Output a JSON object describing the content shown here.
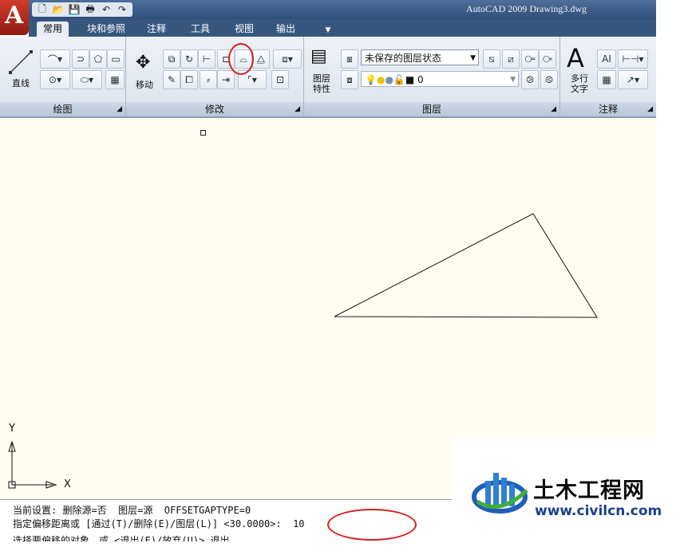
{
  "window": {
    "title": "AutoCAD 2009 Drawing3.dwg",
    "logo_letter": "A"
  },
  "quick_access": [
    "new-icon",
    "open-icon",
    "save-icon",
    "print-icon",
    "undo-icon",
    "redo-icon"
  ],
  "tabs": [
    {
      "label": "常用",
      "active": true
    },
    {
      "label": "块和参照",
      "active": false
    },
    {
      "label": "注释",
      "active": false
    },
    {
      "label": "工具",
      "active": false
    },
    {
      "label": "视图",
      "active": false
    },
    {
      "label": "输出",
      "active": false
    }
  ],
  "panels": {
    "draw": {
      "title": "绘图",
      "line_label": "直线"
    },
    "modify": {
      "title": "修改",
      "move_label": "移动"
    },
    "layers": {
      "title": "图层",
      "props_label_1": "图层",
      "props_label_2": "特性",
      "layer_state": "未保存的图层状态",
      "current_layer": "0"
    },
    "annotation": {
      "title": "注释",
      "mtext_label_1": "多行",
      "mtext_label_2": "文字"
    }
  },
  "ucs": {
    "x_label": "X",
    "y_label": "Y"
  },
  "command_line": {
    "line1": "当前设置: 删除源=否  图层=源  OFFSETGAPTYPE=0",
    "line2": "指定偏移距离或 [通过(T)/删除(E)/图层(L)] <30.0000>:  10",
    "line3": "选择要偏移的对象，或 <退出(E)/放弃(U)> 退出"
  },
  "watermark": {
    "title": "土木工程网",
    "url": "www.civilcn.com"
  },
  "colors": {
    "annotation_circle": "#d41f1f",
    "canvas": "#fffdf1"
  }
}
